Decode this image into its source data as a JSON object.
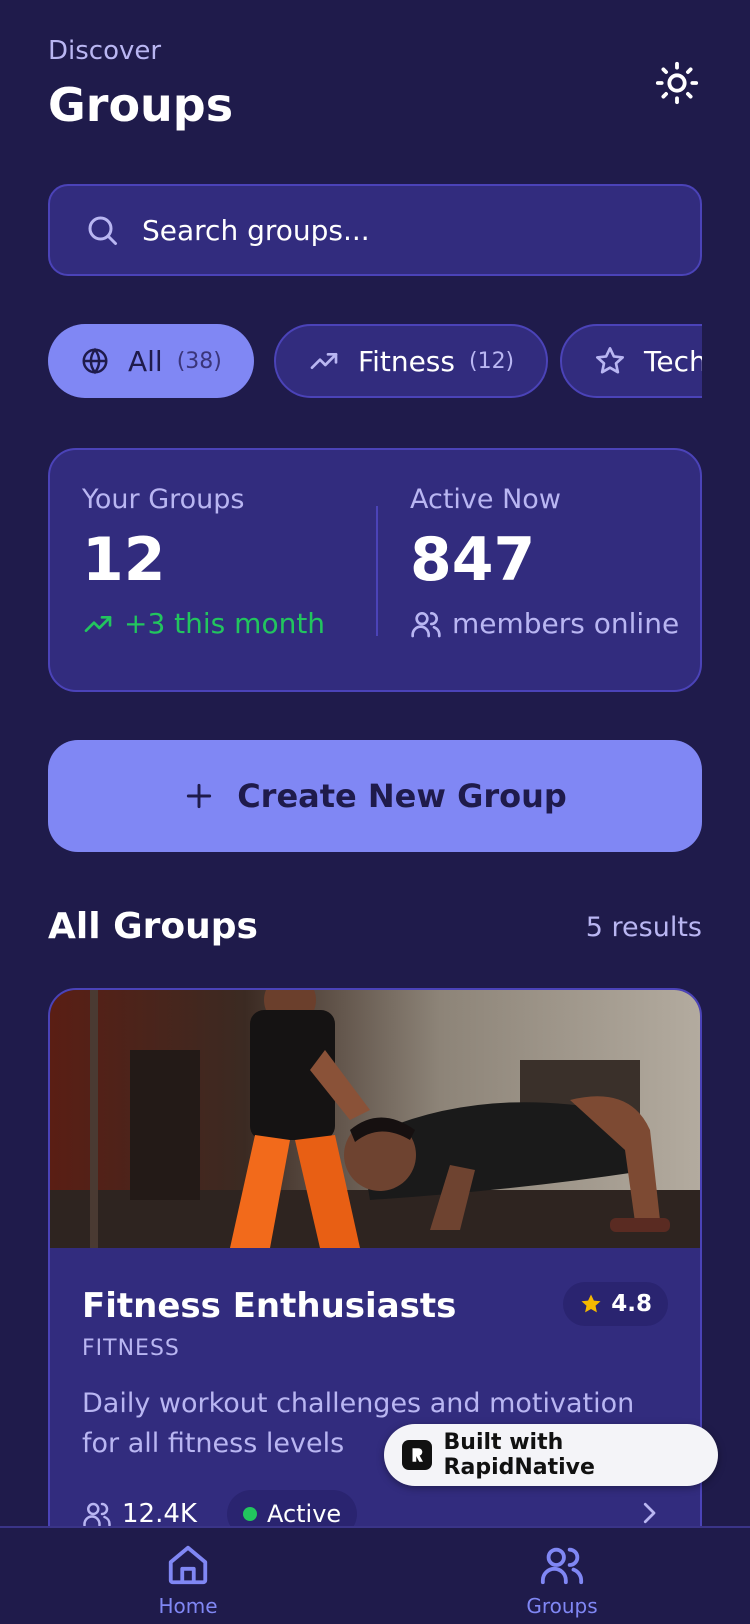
{
  "header": {
    "eyebrow": "Discover",
    "title": "Groups",
    "theme_icon": "sun-icon"
  },
  "search": {
    "placeholder": "Search groups...",
    "icon": "search-icon"
  },
  "filters": [
    {
      "label": "All",
      "count": "(38)",
      "icon": "globe-icon",
      "active": true
    },
    {
      "label": "Fitness",
      "count": "(12)",
      "icon": "trending-up-icon",
      "active": false
    },
    {
      "label": "Tech",
      "count": "",
      "icon": "star-icon",
      "active": false
    }
  ],
  "stats": {
    "your_groups": {
      "label": "Your Groups",
      "value": "12",
      "sub": "+3 this month"
    },
    "active_now": {
      "label": "Active Now",
      "value": "847",
      "sub": "members online"
    }
  },
  "create_button": {
    "label": "Create New Group"
  },
  "section": {
    "title": "All Groups",
    "count": "5 results"
  },
  "group_card": {
    "name": "Fitness Enthusiasts",
    "rating": "4.8",
    "category": "FITNESS",
    "description": "Daily workout challenges and motivation for all fitness levels",
    "members": "12.4K",
    "status": "Active"
  },
  "badge": {
    "label": "Built with RapidNative"
  },
  "tabbar": {
    "items": [
      {
        "label": "Home",
        "icon": "home-icon"
      },
      {
        "label": "Groups",
        "icon": "users-icon"
      }
    ]
  },
  "colors": {
    "background": "#1f1b4b",
    "card": "#322c7e",
    "accent": "#8087f4",
    "muted_text": "#b9b6f2",
    "success": "#22c55e",
    "star": "#f5b800"
  }
}
